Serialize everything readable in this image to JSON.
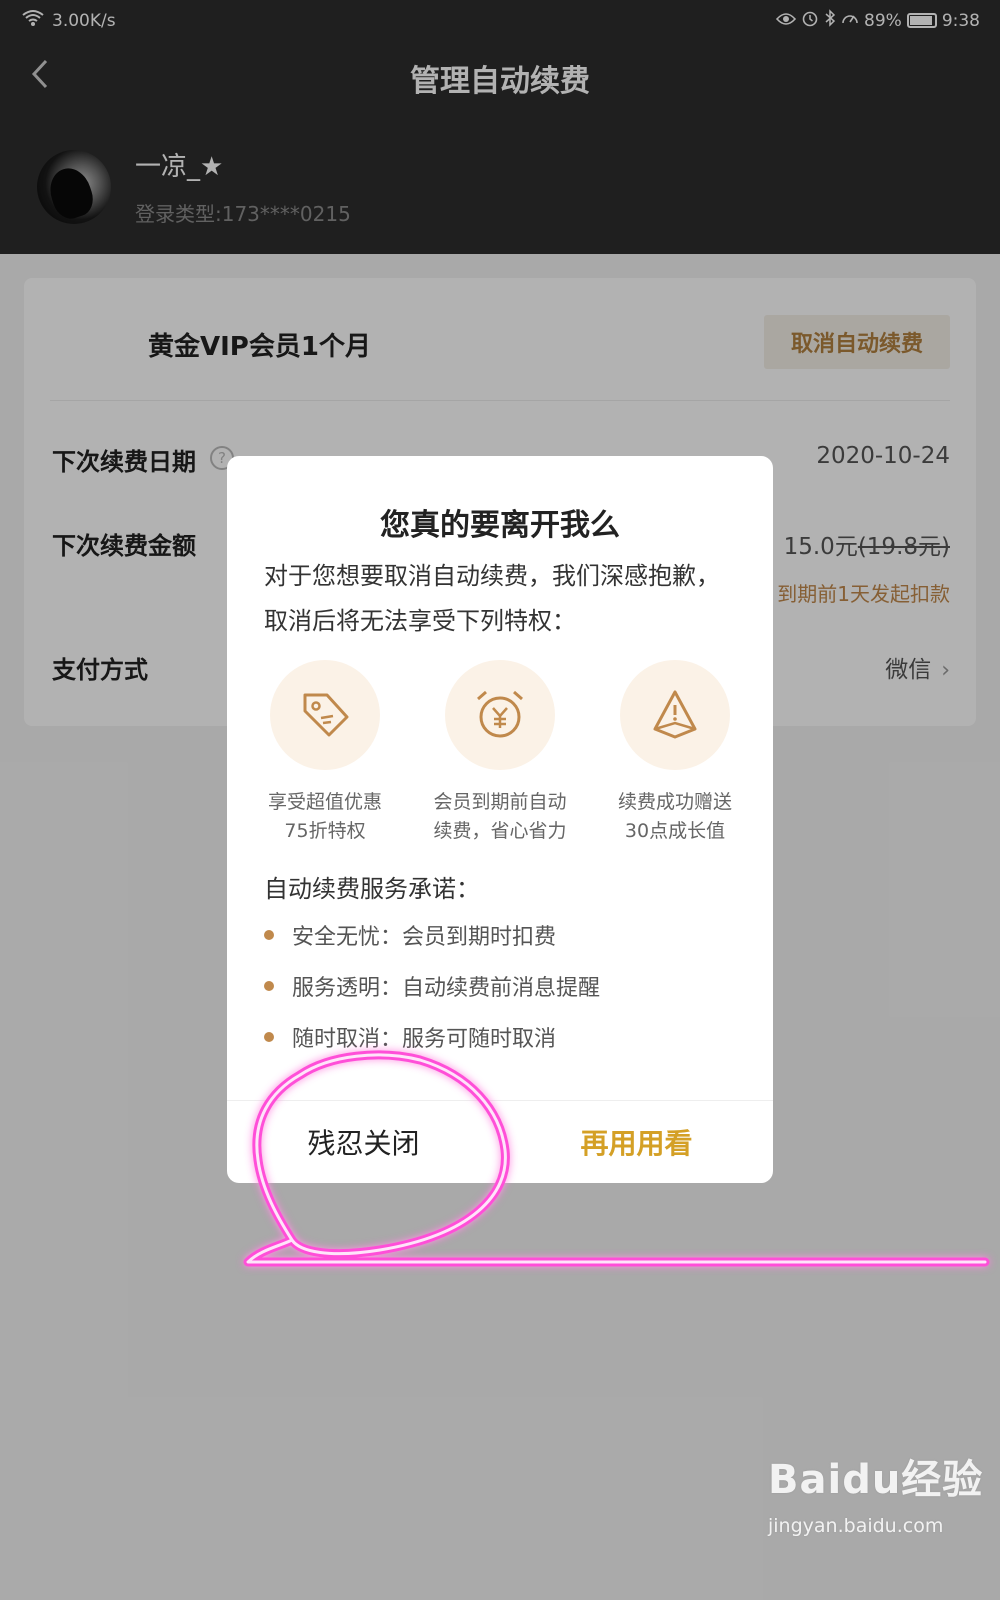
{
  "status_bar": {
    "network_speed": "3.00K/s",
    "battery": "89%",
    "time": "9:38"
  },
  "header": {
    "title": "管理自动续费"
  },
  "profile": {
    "name": "一凉_★",
    "login_type": "登录类型:173****0215"
  },
  "plan": {
    "name": "黄金VIP会员1个月",
    "cancel_button": "取消自动续费",
    "next_date_label": "下次续费日期",
    "next_date_value": "2020-10-24",
    "next_amount_label": "下次续费金额",
    "next_amount_value": "15.0元",
    "original_price": "(19.8元)",
    "deduction_hint": "到期前1天发起扣款",
    "payment_label": "支付方式",
    "payment_value": "微信"
  },
  "modal": {
    "title": "您真的要离开我么",
    "description": "对于您想要取消自动续费，我们深感抱歉，取消后将无法享受下列特权：",
    "perks": [
      {
        "icon": "discount-tag-icon",
        "line1": "享受超值优惠",
        "line2": "75折特权"
      },
      {
        "icon": "yuan-alarm-clock-icon",
        "line1": "会员到期前自动",
        "line2": "续费，省心省力"
      },
      {
        "icon": "growth-warning-icon",
        "line1": "续费成功赠送",
        "line2": "30点成长值"
      }
    ],
    "promise_title": "自动续费服务承诺：",
    "promises": [
      "安全无忧：会员到期时扣费",
      "服务透明：自动续费前消息提醒",
      "随时取消：服务可随时取消"
    ],
    "close_button": "残忍关闭",
    "stay_button": "再用用看"
  },
  "watermark": {
    "logo": "Baidu经验",
    "url": "jingyan.baidu.com"
  },
  "colors": {
    "accent_gold": "#c0894c",
    "stay_button": "#d4a026",
    "annotation_pink": "#ff4fd8",
    "header_bg": "#2d2d2d"
  }
}
